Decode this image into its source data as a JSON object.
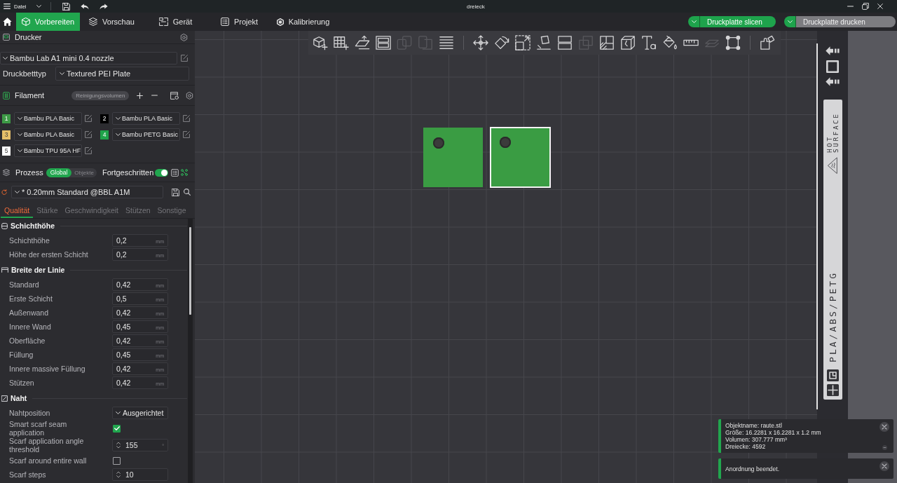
{
  "title_bar": {
    "menu": "Datei",
    "title": "dreieck"
  },
  "main_tabs": [
    {
      "label": "Vorbereiten",
      "selected": true
    },
    {
      "label": "Vorschau",
      "selected": false
    },
    {
      "label": "Gerät",
      "selected": false
    },
    {
      "label": "Projekt",
      "selected": false
    },
    {
      "label": "Kalibrierung",
      "selected": false
    }
  ],
  "actions": [
    {
      "label": "Druckplatte slicen",
      "disabled": false
    },
    {
      "label": "Druckplatte drucken",
      "disabled": true
    }
  ],
  "printer": {
    "title": "Drucker",
    "preset": "Bambu Lab A1 mini 0.4 nozzle",
    "bed_label": "Druckbetttyp",
    "bed_type": "Textured PEI Plate"
  },
  "filament": {
    "title": "Filament",
    "flush_button": "Reinigungsvolumen",
    "slots": [
      {
        "number": "1",
        "color": "#3d9a46",
        "name": "Bambu PLA Basic"
      },
      {
        "number": "2",
        "color": "#000000",
        "name": "Bambu PLA Basic"
      },
      {
        "number": "3",
        "color": "#e6bf6a",
        "name": "Bambu PLA Basic"
      },
      {
        "number": "4",
        "color": "#1fa34a",
        "name": "Bambu PETG Basic"
      },
      {
        "number": "5",
        "color": "#ffffff",
        "name": "Bambu TPU 95A HF"
      }
    ]
  },
  "process": {
    "title": "Prozess",
    "scope": [
      {
        "label": "Global",
        "selected": true
      },
      {
        "label": "Objekte",
        "selected": false
      }
    ],
    "advanced": {
      "label": "Fortgeschritten",
      "on": true
    },
    "preset": "* 0.20mm Standard @BBL A1M",
    "tabs": [
      {
        "label": "Qualität",
        "selected": true
      },
      {
        "label": "Stärke",
        "selected": false
      },
      {
        "label": "Geschwindigkeit",
        "selected": false
      },
      {
        "label": "Stützen",
        "selected": false
      },
      {
        "label": "Sonstige",
        "selected": false
      }
    ],
    "groups": [
      {
        "title": "Schichthöhe",
        "rows": [
          {
            "kind": "number",
            "label": "Schichthöhe",
            "value": "0,2",
            "unit": "mm"
          },
          {
            "kind": "number",
            "label": "Höhe der ersten Schicht",
            "value": "0,2",
            "unit": "mm"
          }
        ]
      },
      {
        "title": "Breite der Linie",
        "rows": [
          {
            "kind": "number",
            "label": "Standard",
            "value": "0,42",
            "unit": "mm"
          },
          {
            "kind": "number",
            "label": "Erste Schicht",
            "value": "0,5",
            "unit": "mm"
          },
          {
            "kind": "number",
            "label": "Außenwand",
            "value": "0,42",
            "unit": "mm"
          },
          {
            "kind": "number",
            "label": "Innere Wand",
            "value": "0,45",
            "unit": "mm"
          },
          {
            "kind": "number",
            "label": "Oberfläche",
            "value": "0,42",
            "unit": "mm"
          },
          {
            "kind": "number",
            "label": "Füllung",
            "value": "0,45",
            "unit": "mm"
          },
          {
            "kind": "number",
            "label": "Innere massive Füllung",
            "value": "0,42",
            "unit": "mm"
          },
          {
            "kind": "number",
            "label": "Stützen",
            "value": "0,42",
            "unit": "mm"
          }
        ]
      },
      {
        "title": "Naht",
        "rows": [
          {
            "kind": "select",
            "label": "Nahtposition",
            "value": "Ausgerichtet"
          },
          {
            "kind": "checkbox",
            "label": "Smart scarf seam application",
            "checked": true
          },
          {
            "kind": "spin",
            "label": "Scarf application angle threshold",
            "value": "155",
            "unit": "°"
          },
          {
            "kind": "checkbox",
            "label": "Scarf around entire wall",
            "checked": false
          },
          {
            "kind": "spin",
            "label": "Scarf steps",
            "value": "10"
          }
        ]
      }
    ]
  },
  "toolbar": [
    {
      "tools": [
        {
          "kind": "add",
          "disabled": false
        },
        {
          "kind": "plate",
          "disabled": false
        },
        {
          "kind": "orient",
          "disabled": false
        },
        {
          "kind": "arrange",
          "disabled": false
        },
        {
          "kind": "objects",
          "disabled": true
        },
        {
          "kind": "parts",
          "disabled": true
        },
        {
          "kind": "layers",
          "disabled": false
        }
      ]
    },
    {
      "tools": [
        {
          "kind": "move",
          "disabled": false
        },
        {
          "kind": "rotate",
          "disabled": false
        },
        {
          "kind": "scale",
          "disabled": false
        },
        {
          "kind": "lay",
          "disabled": false
        },
        {
          "kind": "split",
          "disabled": false
        },
        {
          "kind": "boolean",
          "disabled": true
        },
        {
          "kind": "support",
          "disabled": false
        },
        {
          "kind": "seam",
          "disabled": false
        },
        {
          "kind": "text",
          "disabled": false
        },
        {
          "kind": "paint",
          "disabled": false
        },
        {
          "kind": "measure",
          "disabled": false
        },
        {
          "kind": "assembly",
          "disabled": true
        },
        {
          "kind": "frame",
          "disabled": false
        }
      ]
    },
    {
      "tools": [
        {
          "kind": "explode",
          "disabled": false
        }
      ]
    }
  ],
  "plate": {
    "objects": [
      {
        "selected": false
      },
      {
        "selected": true
      }
    ],
    "warning": "HOT SURFACE",
    "materials": "PLA/ABS/PETG"
  },
  "notifications": [
    {
      "lines": [
        "Objektname: raute.stl",
        "Größe: 16.2281 x 16.2281 x 1.2 mm",
        "Volumen: 307.777 mm³",
        "Dreiecke: 4592"
      ],
      "collapsible": true
    },
    {
      "lines": [
        "Anordnung beendet."
      ],
      "collapsible": false
    }
  ]
}
